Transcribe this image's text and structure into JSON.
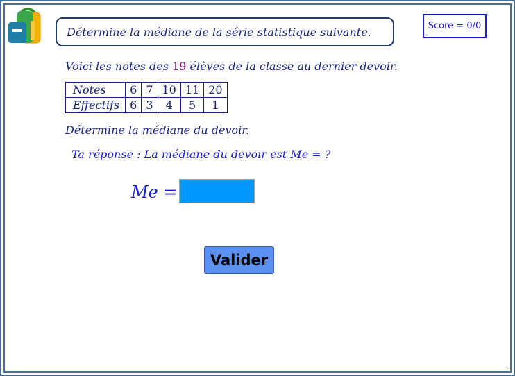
{
  "title": "Détermine la médiane de la série statistique suivante.",
  "score": {
    "label": "Score = 0/0"
  },
  "intro": {
    "before": "Voici les notes des ",
    "count": "19",
    "after": " élèves de la classe au dernier devoir."
  },
  "table": {
    "row_headers": [
      "Notes",
      "Effectifs"
    ],
    "notes": [
      "6",
      "7",
      "10",
      "11",
      "20"
    ],
    "effectifs": [
      "6",
      "3",
      "4",
      "5",
      "1"
    ]
  },
  "question": "Détermine la médiane du devoir.",
  "answer_prompt": "Ta réponse :  La médiane du devoir est Me = ?",
  "input": {
    "label": "Me =",
    "value": ""
  },
  "validate_button": "Valider",
  "colors": {
    "frame": "#4a6f94",
    "text": "#1a237e",
    "accent": "#1a1acd",
    "input_bg": "#0099ff",
    "button_bg": "#5b8ff0",
    "count": "#800080"
  },
  "icons": {
    "logo": "school-backpack-icon"
  }
}
